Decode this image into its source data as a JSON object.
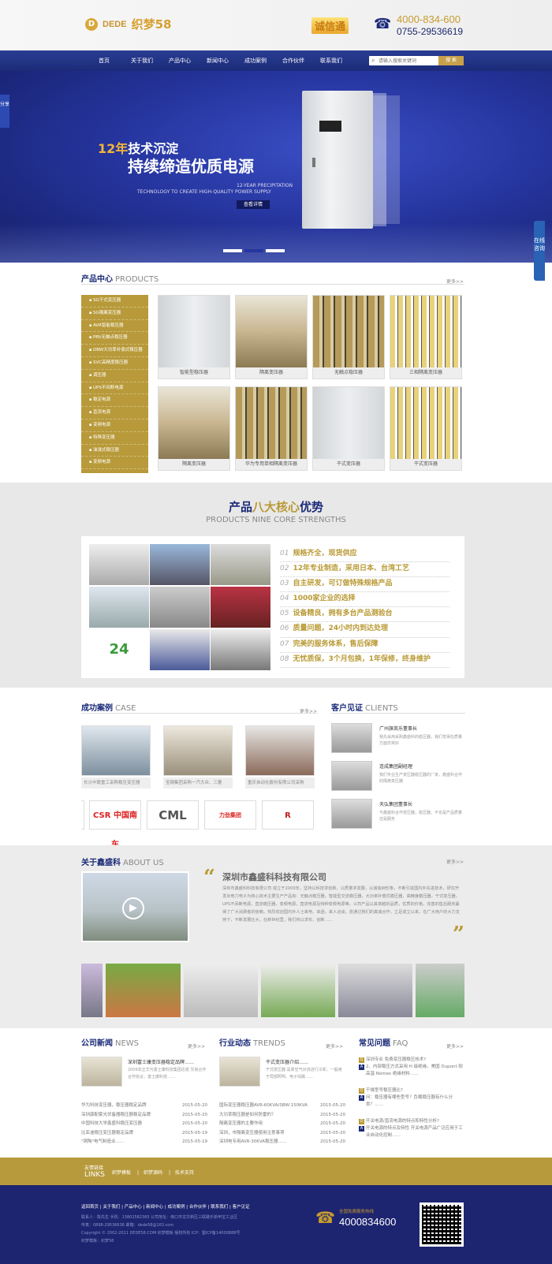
{
  "header": {
    "logo_d": "D",
    "logo_text": "DEDE",
    "logo_sub": "织梦58",
    "cx_badge": "诚信通",
    "tel1": "4000-834-600",
    "tel2": "0755-29536619"
  },
  "nav": {
    "items": [
      "首页",
      "关于我们",
      "产品中心",
      "新闻中心",
      "成功案例",
      "合作伙伴",
      "联系我们"
    ],
    "search_placeholder": "请输入搜索关键词",
    "search_button": "搜 索"
  },
  "banner": {
    "h1_year": "12年",
    "h1_rest": "技术沉淀",
    "h2": "持续缔造优质电源",
    "en1": "12-YEAR PRECIPITATION",
    "en2": "TECHNOLOGY TO CREATE HIGH-QUALITY POWER SUPPLY",
    "button": "查看详情",
    "share": "分享",
    "consult": "在线咨询"
  },
  "products": {
    "title": "产品中心",
    "title_en": "PRODUCTS",
    "more": "更多>>",
    "categories": [
      "SG干式变压器",
      "SG隔离变压器",
      "AVR智能稳压器",
      "PBV无触点稳压器",
      "DBW大功率补偿式稳压器",
      "SVC高精度稳压器",
      "调压器",
      "UPS不间断电源",
      "稳定电源",
      "直流电源",
      "变频电源",
      "特殊变压器",
      "油浸式稳压器",
      "变频电源"
    ],
    "items": [
      {
        "label": "智能型稳压器",
        "kind": "cab"
      },
      {
        "label": "隔离变压器",
        "kind": "tr"
      },
      {
        "label": "无触点稳压器",
        "kind": "stack"
      },
      {
        "label": "三相隔离变压器",
        "kind": "yel"
      },
      {
        "label": "隔离变压器",
        "kind": "tr"
      },
      {
        "label": "华为专用单相隔离变压器",
        "kind": "stack"
      },
      {
        "label": "干式变压器",
        "kind": "cab"
      },
      {
        "label": "干式变压器",
        "kind": "yel"
      }
    ]
  },
  "strengths": {
    "title_a": "产品",
    "title_b": "八大核心",
    "title_c": "优势",
    "subtitle": "PRODUCTS NINE CORE STRENGTHS",
    "items": [
      {
        "n": "01",
        "t": "规格齐全，现货供应"
      },
      {
        "n": "02",
        "t": "12年专业制造，采用日本、台湾工艺"
      },
      {
        "n": "03",
        "t": "自主研发，可订做特殊规格产品"
      },
      {
        "n": "04",
        "t": "1000家企业的选择"
      },
      {
        "n": "05",
        "t": "设备精良，拥有多台产品测验台"
      },
      {
        "n": "06",
        "t": "质量问题，24小时内到达处理"
      },
      {
        "n": "07",
        "t": "完美的服务体系，售后保障"
      },
      {
        "n": "08",
        "t": "无忧质保，3个月包换，1年保修，终身维护"
      }
    ]
  },
  "cases": {
    "title": "成功案例",
    "title_en": "CASE",
    "more": "更多>>",
    "items": [
      "长沙中联重工采购稳压变压器",
      "宝钢集团采购一汽大众、三菱",
      "重庆自动化股份有限公司采购"
    ],
    "partners": [
      "CSR 中国南车",
      "CML",
      "力劲集团",
      "R"
    ]
  },
  "clients": {
    "title": "客户见证",
    "title_en": "CLIENTS",
    "items": [
      {
        "name": "广州旗英乐董事长",
        "desc": "我先采用采购鑫盛科的稳压器，我们觉得在质量方面非常好"
      },
      {
        "name": "连成集团副经理",
        "desc": "我们专业生产变压器稳压器的厂家，鑫盛科合作的隔离变压器"
      },
      {
        "name": "天弘集团董事长",
        "desc": "与鑫盛科合作变压器，稳压器，不论是产品质量还是服务"
      }
    ]
  },
  "about": {
    "title": "关于鑫盛科",
    "title_en": "ABOUT US",
    "more": "更多>>",
    "company": "深圳市鑫盛科科技有限公司",
    "text": "深圳市鑫盛科科技有限公司 成立于2000年，坚持以科技求创新，以质量求发展，以诚信树形象，不断引进国内外先进技术，研究开发出电力电子为核心技术主要生产产品有：无触点稳压器，智能型交流稳压器，大功率补偿式稳压器，高精度稳压器，干式变压器，UPS不间断电源，直流稳压器，变频电源，直流电源及特种变频电源等。公司产品以其卓越的品质，优质的价格，完善的售后服务赢得了广大消费者的信赖。热烈欢迎国内外人士来电、来函，来人洽谈，愿通过我们的真诚合作，立足成立以来，在广大用户的大力支持下，不断发展壮大，在新世纪里，我们将以求实、创新……"
  },
  "news": {
    "title": "公司新闻",
    "title_en": "NEWS",
    "more": "更多>>",
    "feat_title": "深圳富士康变压器稳定品牌……",
    "feat_desc": "2009年正式与富士康科技集团达成 交易合作 合作协议，富士康科技……",
    "items": [
      {
        "t": "华为科技变压器，稳压器稳定品牌",
        "d": "2015-05-20"
      },
      {
        "t": "深圳康配套光伏备器稳压器稳定品牌",
        "d": "2015-05-20"
      },
      {
        "t": "中国科技大学鑫盛科稳压变压器",
        "d": "2015-05-20"
      },
      {
        "t": "比亚迪稳压变压器稳定品牌",
        "d": "2015-05-19"
      },
      {
        "t": "\"铜陶\"电气制造业……",
        "d": "2015-05-19"
      }
    ]
  },
  "trends": {
    "title": "行业动态",
    "title_en": "TRENDS",
    "more": "更多>>",
    "feat_title": "干式变压器介绍……",
    "feat_desc": "干式变压器 是靠空气对流进行冷却，一般用于局部照明、电子线路……",
    "items": [
      {
        "t": "国际变压器稳压器AVR-60KVA/SBW-150KVA",
        "d": "2015-05-20"
      },
      {
        "t": "大功率稳压器是如何防雷的？",
        "d": "2015-05-20"
      },
      {
        "t": "隔离变压器的主要作用",
        "d": "2015-05-20"
      },
      {
        "t": "深圳，市隔离变压器使用注意事项",
        "d": "2015-05-20"
      },
      {
        "t": "深圳电专用AVR-30KVA稳压器……",
        "d": "2015-05-20"
      }
    ]
  },
  "faq": {
    "title": "常见问题",
    "title_en": "FAQ",
    "more": "更多>>",
    "items": [
      {
        "q": "深圳专业 免费变压器稳压技术?",
        "a": "2、内部稳压方式采用 H 级绝缘，美国 Dupont 耐高温 Nomex 绝缘材料……"
      },
      {
        "q": "干燥型号稳压器比?",
        "a": "问：稳压器有哪些型号？负载稳压器有什么分类？……"
      },
      {
        "q": "开关电源/直流电源的特点和特性分析?",
        "a": "开关电源的特点及特性 开关电源产品广泛应用于工业自动化控制……"
      }
    ]
  },
  "links": {
    "title_cn": "友情链接",
    "title_en": "LINKS",
    "items": [
      "织梦模板",
      "织梦源码",
      "技术支持"
    ]
  },
  "footer": {
    "nav": [
      "返回首页",
      "关于我们",
      "产品中心",
      "新闻中心",
      "成功案例",
      "合作伙伴",
      "联系我们",
      "客户见证"
    ],
    "contact": "联系人：陈先生 手机：13802582365 公司地址：南口市龙华新区三联路乐新甲宝工业区",
    "fax": "传真：0898-29536636 邮箱：dede58@163.com",
    "copyright": "Copyright © 2002-2011 DEDE58.COM 织梦模板 版权所有 ICP：蜀ICP备14000888号",
    "support": "织梦模板：织梦58",
    "tel_label": "全国免费服务热线",
    "tel": "4000834600"
  }
}
